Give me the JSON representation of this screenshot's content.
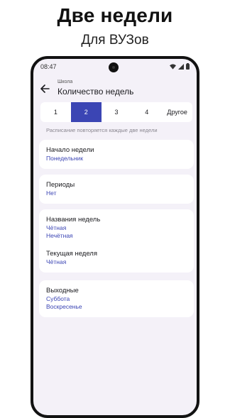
{
  "promo": {
    "title": "Две недели",
    "subtitle": "Для ВУЗов"
  },
  "statusbar": {
    "time": "08:47",
    "icons": [
      "wifi-icon",
      "signal-icon",
      "battery-icon"
    ]
  },
  "appbar": {
    "back_icon": "arrow-back-icon",
    "subtitle": "Школа",
    "title": "Количество недель"
  },
  "week_selector": {
    "options": [
      "1",
      "2",
      "3",
      "4",
      "Другое"
    ],
    "selected": "2"
  },
  "hint": "Расписание повторяется каждые две недели",
  "settings": {
    "week_start": {
      "label": "Начало недели",
      "value": "Понедельник"
    },
    "periods": {
      "label": "Периоды",
      "value": "Нет"
    },
    "week_names": {
      "label": "Названия недель",
      "values": [
        "Чётная",
        "Нечётная"
      ]
    },
    "current_week": {
      "label": "Текущая неделя",
      "value": "Чётная"
    },
    "weekends": {
      "label": "Выходные",
      "values": [
        "Суббота",
        "Воскресенье"
      ]
    }
  },
  "colors": {
    "accent": "#3b45b4",
    "background": "#f4f1f8",
    "card": "#ffffff"
  }
}
